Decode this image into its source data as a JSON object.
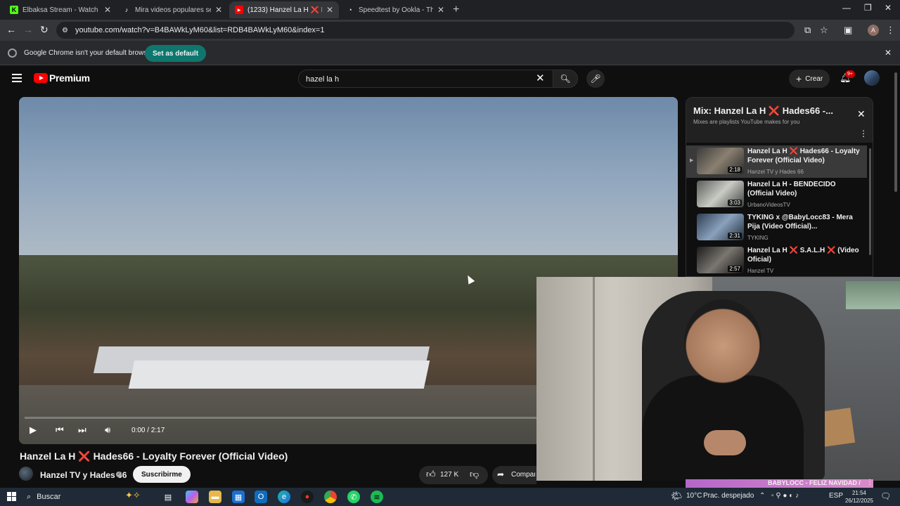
{
  "browser": {
    "tabs": [
      {
        "title": "Elbaksa Stream - Watch Live on",
        "favicon": "K",
        "fav_color": "#53fc18",
        "active": false
      },
      {
        "title": "Mira videos populares seleccio",
        "favicon": "♪",
        "fav_color": "#111111",
        "active": false
      },
      {
        "title": "(1233) Hanzel La H ❌ Hades6",
        "favicon": "▶",
        "fav_color": "#ff0000",
        "active": true
      },
      {
        "title": "Speedtest by Ookla - The Glob",
        "favicon": "◔",
        "fav_color": "#202124",
        "active": false
      }
    ],
    "url": "youtube.com/watch?v=B4BAWkLyM60&list=RDB4BAWkLyM60&index=1",
    "infobar_message": "Google Chrome isn't your default browser",
    "set_default_label": "Set as default"
  },
  "youtube": {
    "logo_text": "Premium",
    "search_value": "hazel la h",
    "create_label": "Crear",
    "notification_count": "9+",
    "video": {
      "time": "0:00 / 2:17",
      "title": "Hanzel La H ❌ Hades66 - Loyalty Forever (Official Video)",
      "channel": "Hanzel TV y Hades 66",
      "subscribe_label": "Suscribirme",
      "likes": "127 K",
      "share_label": "Compartir"
    },
    "playlist": {
      "title": "Mix: Hanzel La H ❌ Hades66 -...",
      "subtitle": "Mixes are playlists YouTube makes for you",
      "items": [
        {
          "title": "Hanzel La H ❌ Hades66 - Loyalty Forever (Official Video)",
          "channel": "Hanzel TV y Hades 66",
          "duration": "2:18",
          "active": true,
          "thumb": "linear-gradient(135deg,#3b3b3b,#8a8070,#2a2a2a)"
        },
        {
          "title": "Hanzel La H - BENDECIDO (Official Video)",
          "channel": "UrbanoVideosTV",
          "duration": "3:03",
          "active": false,
          "thumb": "linear-gradient(135deg,#5a5f5a,#c9cbc4,#3c3f3c)"
        },
        {
          "title": "TYKING x @BabyLocc83 - Mera Pija (Video Official)...",
          "channel": "TYKING",
          "duration": "2:31",
          "active": false,
          "thumb": "linear-gradient(135deg,#2f3e52,#8aa2bd,#1f2a38)"
        },
        {
          "title": "Hanzel La H ❌ S.A.L.H ❌ (Video Oficial)",
          "channel": "Hanzel TV",
          "duration": "2:57",
          "active": false,
          "thumb": "linear-gradient(135deg,#1c1c1c,#7a7670,#111)"
        }
      ],
      "next_item_title": "BABYLOCC - FELIZ NAVIDAD /"
    }
  },
  "taskbar": {
    "search_placeholder": "Buscar",
    "weather": "10°C",
    "weather_desc": "Prac. despejado",
    "language": "ESP",
    "time": "21:54",
    "date": "26/12/2025"
  },
  "colors": {
    "yt_red": "#ff0000",
    "set_default_bg": "#0f766e",
    "active_playlist_bg": "#3a3a3a"
  }
}
